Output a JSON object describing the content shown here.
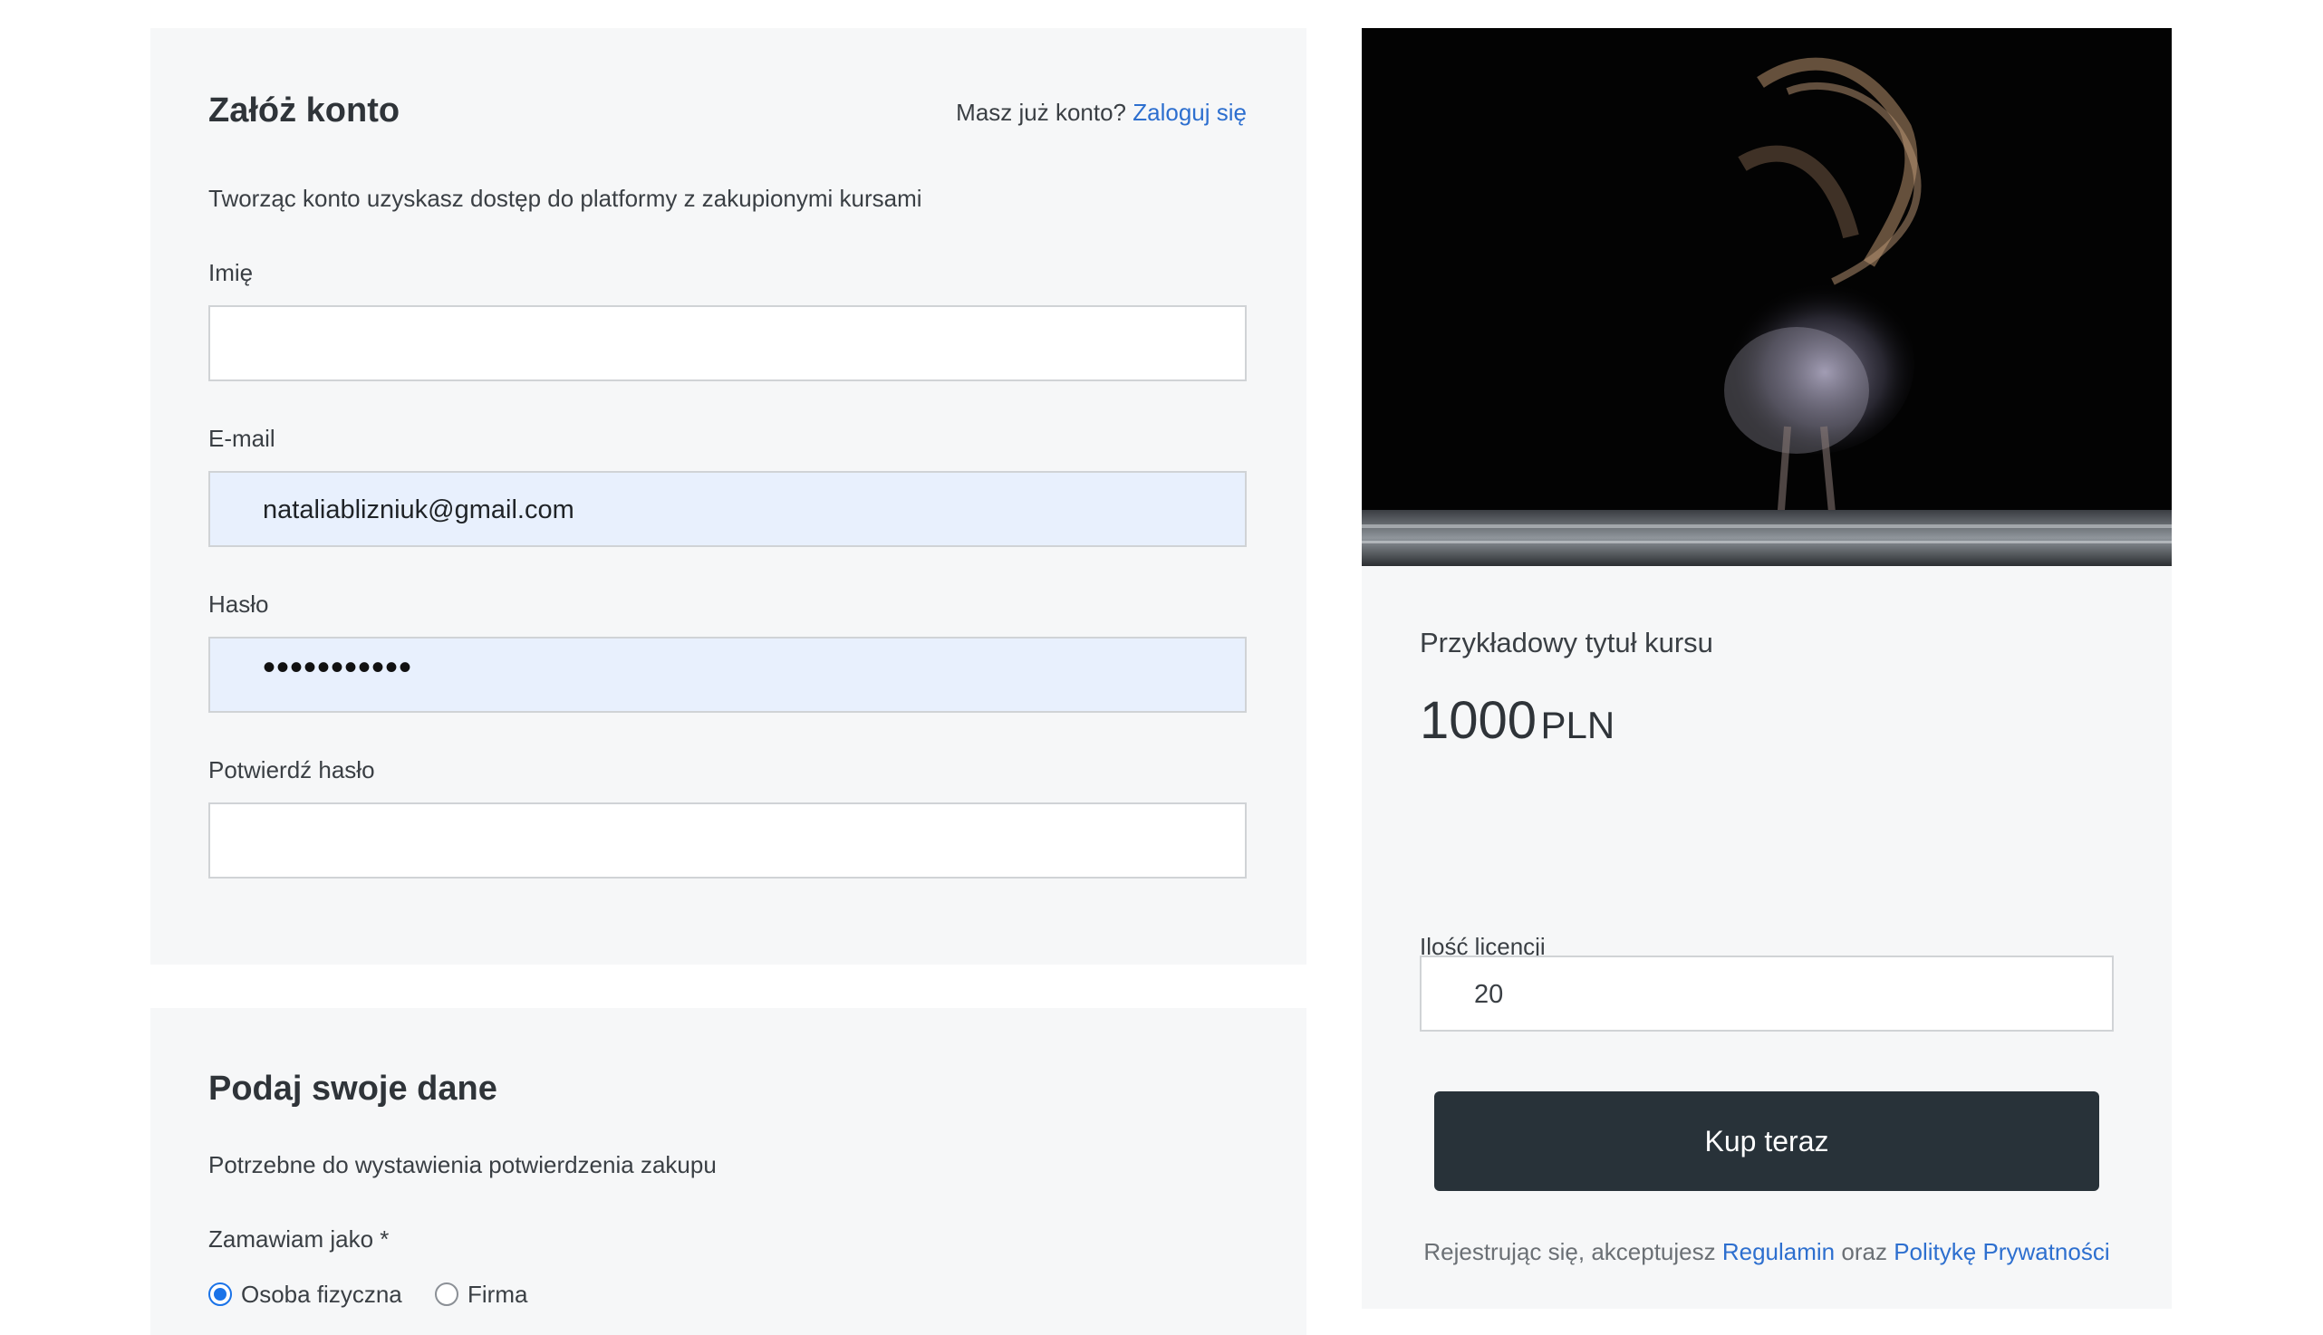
{
  "account": {
    "title": "Załóż konto",
    "login_prompt": "Masz już konto?",
    "login_link": "Zaloguj się",
    "subtitle": "Tworząc konto uzyskasz dostęp do platformy z zakupionymi kursami",
    "fields": {
      "name": {
        "label": "Imię",
        "value": ""
      },
      "email": {
        "label": "E-mail",
        "value": "nataliablizniuk@gmail.com"
      },
      "password": {
        "label": "Hasło",
        "value": "•••••••••••"
      },
      "confirm": {
        "label": "Potwierdź hasło",
        "value": ""
      }
    }
  },
  "details": {
    "title": "Podaj swoje dane",
    "subtitle": "Potrzebne do wystawienia potwierdzenia zakupu",
    "order_as_label": "Zamawiam jako *",
    "options": [
      {
        "label": "Osoba fizyczna",
        "checked": true
      },
      {
        "label": "Firma",
        "checked": false
      }
    ]
  },
  "product": {
    "image_icon": "dancer-photo",
    "title": "Przykładowy tytuł kursu",
    "price": "1000",
    "currency": "PLN",
    "license_label": "Ilość licencji",
    "license_value": "20",
    "buy_label": "Kup teraz",
    "terms": {
      "prefix": "Rejestrując się, akceptujesz",
      "regulamin": "Regulamin",
      "oraz": "oraz",
      "privacy": "Politykę Prywatności"
    }
  },
  "colors": {
    "link": "#2d6fcf",
    "button": "#283239",
    "panel": "#f6f7f8",
    "autofill": "#e8f0fd",
    "radio": "#1a73e8"
  }
}
